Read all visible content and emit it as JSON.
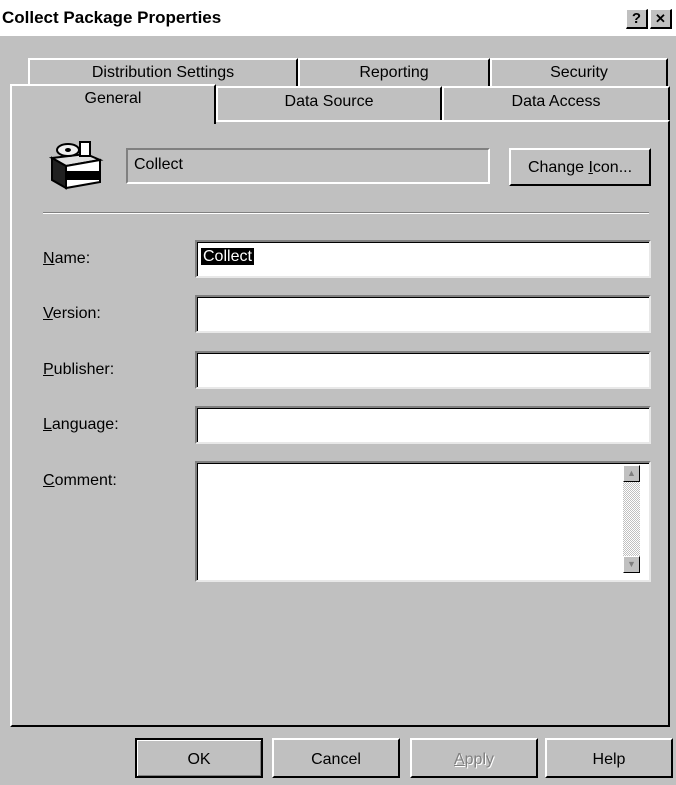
{
  "window": {
    "title": "Collect Package Properties",
    "help_glyph": "?",
    "close_glyph": "✕"
  },
  "tabs": {
    "back_row": [
      "Distribution Settings",
      "Reporting",
      "Security"
    ],
    "front_row": [
      "General",
      "Data Source",
      "Data Access"
    ],
    "active": "General"
  },
  "general": {
    "package_icon": "package-icon",
    "icon_name_value": "Collect",
    "change_icon": {
      "pre": "Change ",
      "mnemonic": "I",
      "post": "con..."
    },
    "fields": {
      "name": {
        "mnemonic": "N",
        "rest": "ame:",
        "value": "Collect"
      },
      "version": {
        "mnemonic": "V",
        "rest": "ersion:",
        "value": ""
      },
      "publisher": {
        "mnemonic": "P",
        "rest": "ublisher:",
        "value": ""
      },
      "language": {
        "mnemonic": "L",
        "rest": "anguage:",
        "value": ""
      },
      "comment": {
        "mnemonic": "C",
        "rest": "omment:",
        "value": ""
      }
    }
  },
  "buttons": {
    "ok": "OK",
    "cancel": "Cancel",
    "apply": {
      "mnemonic": "A",
      "rest": "pply",
      "enabled": false
    },
    "help": "Help"
  },
  "colors": {
    "face": "#c0c0c0",
    "shadow": "#808080",
    "highlight": "#ffffff",
    "title_bar": "#ffffff",
    "selection": "#000000"
  }
}
